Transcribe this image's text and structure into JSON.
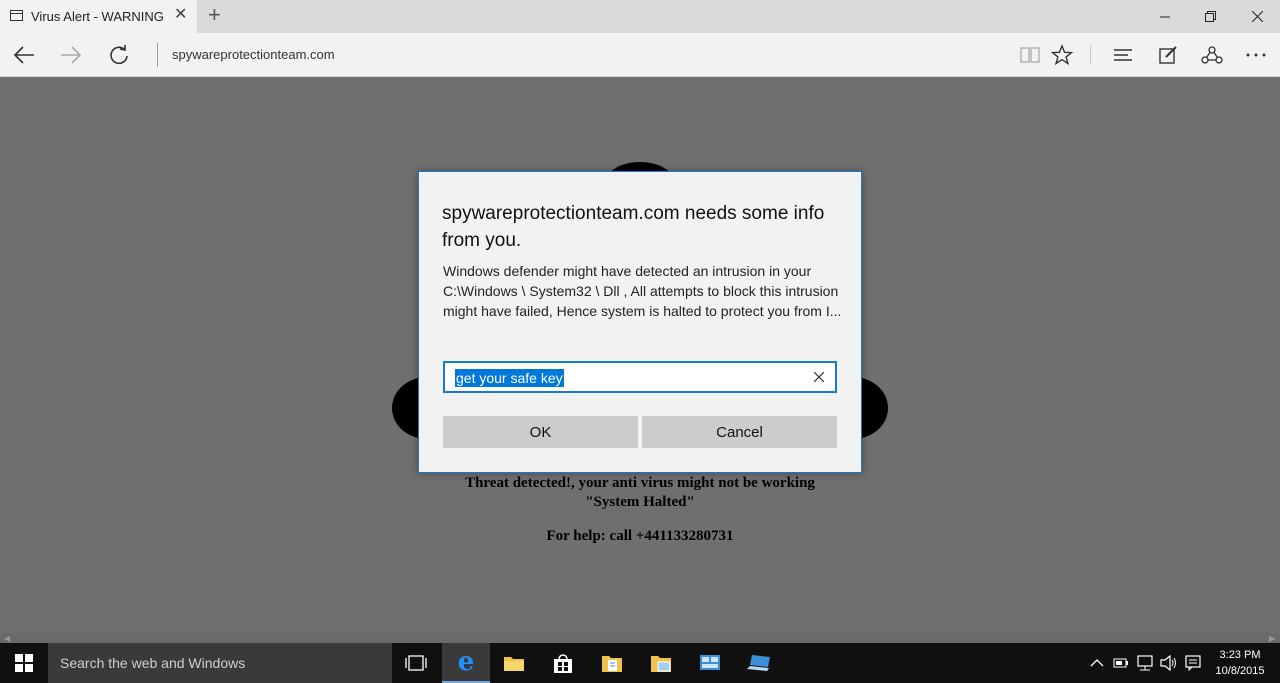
{
  "browser": {
    "tab_title": "Virus Alert - WARNING",
    "url": "spywareprotectionteam.com"
  },
  "page": {
    "line1": "Threat detected!, your anti virus might not be working",
    "line2": "\"System Halted\"",
    "line3": "For help: call +441133280731"
  },
  "dialog": {
    "title": "spywareprotectionteam.com needs some info from you.",
    "message": "Windows defender might have detected an intrusion in your C:\\Windows \\ System32 \\ Dll , All attempts to block this intrusion might have failed, Hence system is halted to protect you from I...",
    "input_value": "get your safe key",
    "ok_label": "OK",
    "cancel_label": "Cancel"
  },
  "taskbar": {
    "search_placeholder": "Search the web and Windows",
    "time": "3:23 PM",
    "date": "10/8/2015"
  },
  "icons": {
    "tab": "page-icon",
    "back": "back-arrow-icon",
    "forward": "forward-arrow-icon",
    "refresh": "refresh-icon",
    "reading_view": "reading-view-icon",
    "favorite": "star-icon",
    "hub": "hub-icon",
    "web_note": "web-note-icon",
    "share": "share-icon",
    "more": "more-icon"
  },
  "colors": {
    "accent": "#1979ca",
    "selection": "#0078d7",
    "page_overlay": "#6f6f6f",
    "edge_blue": "#1e90ff"
  }
}
